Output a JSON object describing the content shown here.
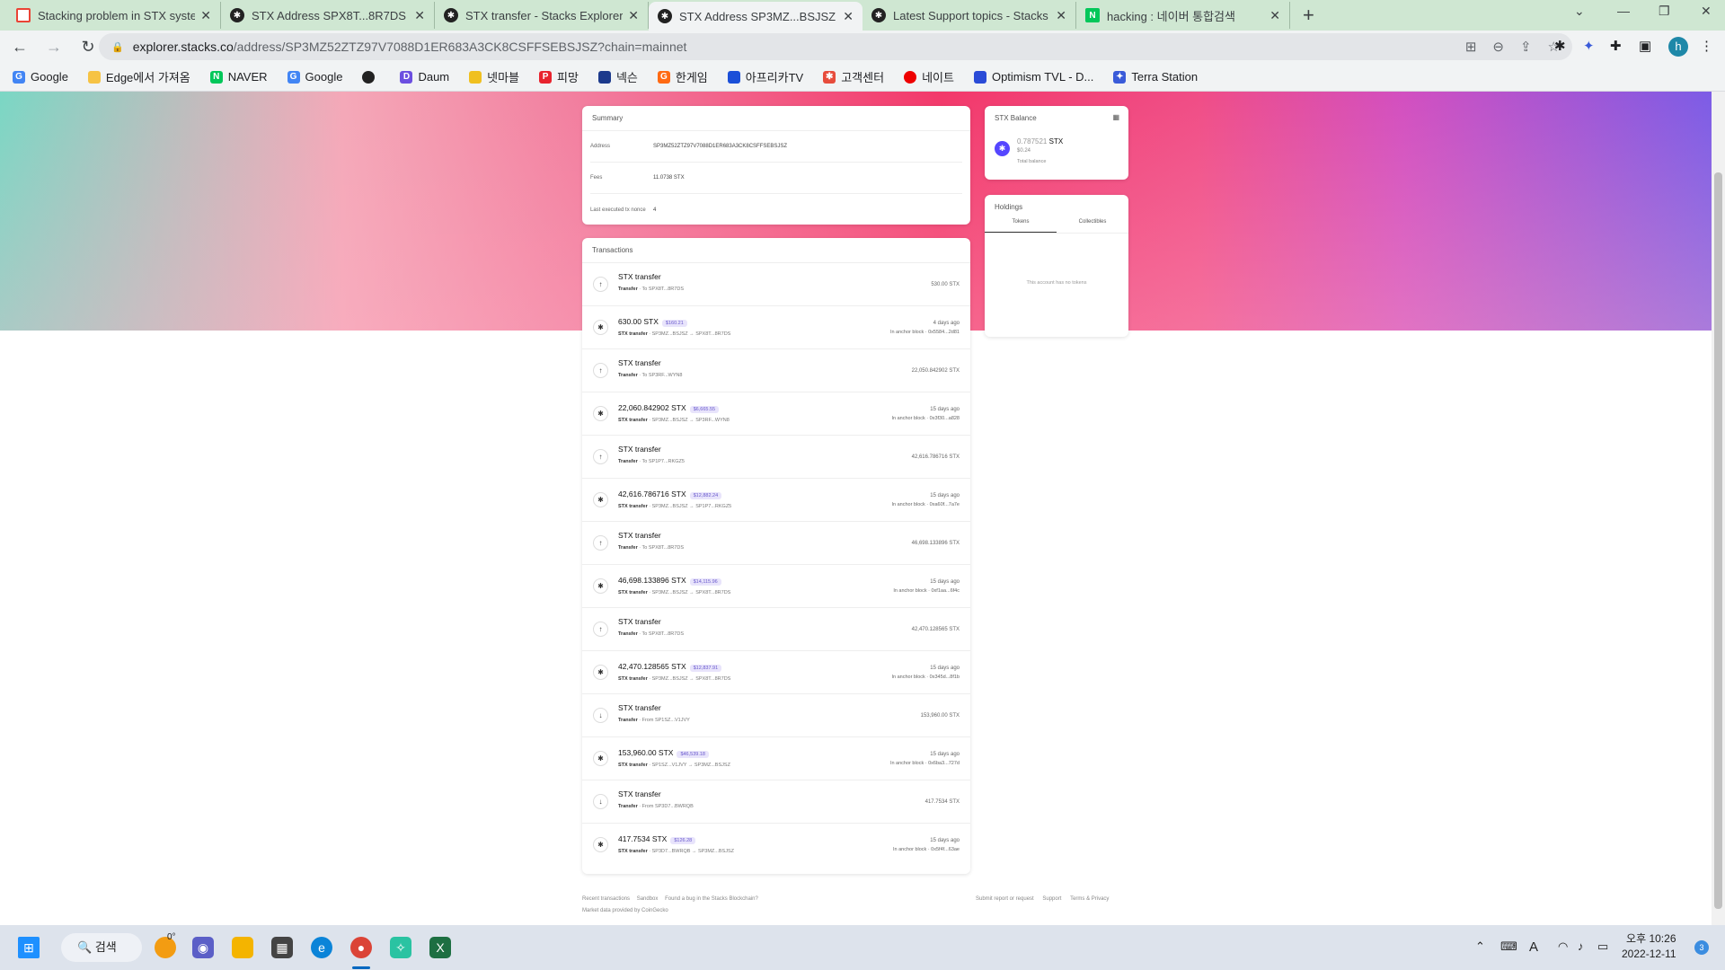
{
  "browser": {
    "tabs": [
      {
        "title": "Stacking problem in STX system",
        "icon": "gmail-icon"
      },
      {
        "title": "STX Address SPX8T...8R7DS - St",
        "icon": "stacks-icon"
      },
      {
        "title": "STX transfer - Stacks Explorer b",
        "icon": "stacks-icon"
      },
      {
        "title": "STX Address SP3MZ...BSJSZ - St",
        "icon": "stacks-icon"
      },
      {
        "title": "Latest Support topics - Stacks F",
        "icon": "stacks-icon"
      },
      {
        "title": "hacking : 네이버 통합검색",
        "icon": "naver-icon"
      }
    ],
    "url_host": "explorer.stacks.co",
    "url_path": "/address/SP3MZ52ZTZ97V7088D1ER683A3CK8CSFFSEBSJSZ?chain=mainnet",
    "avatar_letter": "h",
    "bookmarks": [
      "Google",
      "Edge에서 가져옴",
      "NAVER",
      "Google",
      "",
      "Daum",
      "넷마블",
      "피망",
      "넥슨",
      "한게임",
      "아프리카TV",
      "고객센터",
      "네이트",
      "Optimism TVL - D...",
      "Terra Station"
    ]
  },
  "summary": {
    "title": "Summary",
    "address_label": "Address",
    "address_value": "SP3MZ52ZTZ97V7088D1ER683A3CK8CSFFSEBSJSZ",
    "fees_label": "Fees",
    "fees_value": "11.0738 STX",
    "nonce_label": "Last executed tx nonce",
    "nonce_value": "4"
  },
  "balance": {
    "title": "STX Balance",
    "amount_dim": "0.",
    "amount_main": "787521",
    "unit": "STX",
    "usd": "$0.24",
    "caption": "Total balance"
  },
  "holdings": {
    "title": "Holdings",
    "tab_tokens": "Tokens",
    "tab_collectibles": "Collectibles",
    "empty": "This account has no tokens"
  },
  "transactions": {
    "title": "Transactions",
    "items": [
      {
        "kind": "out",
        "title": "STX transfer",
        "type": "Transfer",
        "detail": "To SPX8T...8R7DS",
        "amount": "530.00 STX"
      },
      {
        "kind": "stx",
        "title": "630.00 STX",
        "usd": "$160.21",
        "type": "STX transfer",
        "detail": "SP3MZ...BSJSZ → SPX8T...8R7DS",
        "time": "4 days ago",
        "block": "In anchor block · 0x5584...2d81"
      },
      {
        "kind": "out",
        "title": "STX transfer",
        "type": "Transfer",
        "detail": "To SP3RF...WYN8",
        "amount": "22,050.842902 STX"
      },
      {
        "kind": "stx",
        "title": "22,060.842902 STX",
        "usd": "$6,665.55",
        "type": "STX transfer",
        "detail": "SP3MZ...BSJSZ → SP3RF...WYN8",
        "time": "15 days ago",
        "block": "In anchor block · 0x3f30...a828"
      },
      {
        "kind": "out",
        "title": "STX transfer",
        "type": "Transfer",
        "detail": "To SP1P7...RKGZ5",
        "amount": "42,616.786716 STX"
      },
      {
        "kind": "stx",
        "title": "42,616.786716 STX",
        "usd": "$12,882.24",
        "type": "STX transfer",
        "detail": "SP3MZ...BSJSZ → SP1P7...RKGZ5",
        "time": "15 days ago",
        "block": "In anchor block · 0xa60f...7a7e"
      },
      {
        "kind": "out",
        "title": "STX transfer",
        "type": "Transfer",
        "detail": "To SPX8T...8R7DS",
        "amount": "46,698.133896 STX"
      },
      {
        "kind": "stx",
        "title": "46,698.133896 STX",
        "usd": "$14,115.96",
        "type": "STX transfer",
        "detail": "SP3MZ...BSJSZ → SPX8T...8R7DS",
        "time": "15 days ago",
        "block": "In anchor block · 0xf1aa...6f4c"
      },
      {
        "kind": "out",
        "title": "STX transfer",
        "type": "Transfer",
        "detail": "To SPX8T...8R7DS",
        "amount": "42,470.128565 STX"
      },
      {
        "kind": "stx",
        "title": "42,470.128565 STX",
        "usd": "$12,837.91",
        "type": "STX transfer",
        "detail": "SP3MZ...BSJSZ → SPX8T...8R7DS",
        "time": "15 days ago",
        "block": "In anchor block · 0x345d...8f1b"
      },
      {
        "kind": "in",
        "title": "STX transfer",
        "type": "Transfer",
        "detail": "From SP1SZ...V1JVY",
        "amount": "153,960.00 STX"
      },
      {
        "kind": "stx",
        "title": "153,960.00 STX",
        "usd": "$46,539.18",
        "type": "STX transfer",
        "detail": "SP1SZ...V1JVY → SP3MZ...BSJSZ",
        "time": "15 days ago",
        "block": "In anchor block · 0x6ba3...727d"
      },
      {
        "kind": "in",
        "title": "STX transfer",
        "type": "Transfer",
        "detail": "From SP3D7...BWRQB",
        "amount": "417.7534 STX"
      },
      {
        "kind": "stx",
        "title": "417.7534 STX",
        "usd": "$126.28",
        "type": "STX transfer",
        "detail": "SP3D7...BWRQB → SP3MZ...BSJSZ",
        "time": "15 days ago",
        "block": "In anchor block · 0x5f4f...63ae"
      }
    ]
  },
  "footer": {
    "recent": "Recent transactions",
    "sandbox": "Sandbox",
    "bug": "Found a bug in the Stacks Blockchain?",
    "market": "Market data provided by CoinGecko",
    "submit": "Submit report or request",
    "support": "Support",
    "terms": "Terms & Privacy"
  },
  "taskbar": {
    "search_label": "검색",
    "weather": "0°",
    "time": "오후 10:26",
    "date": "2022-12-11",
    "notif_count": "3",
    "ime": "A"
  }
}
